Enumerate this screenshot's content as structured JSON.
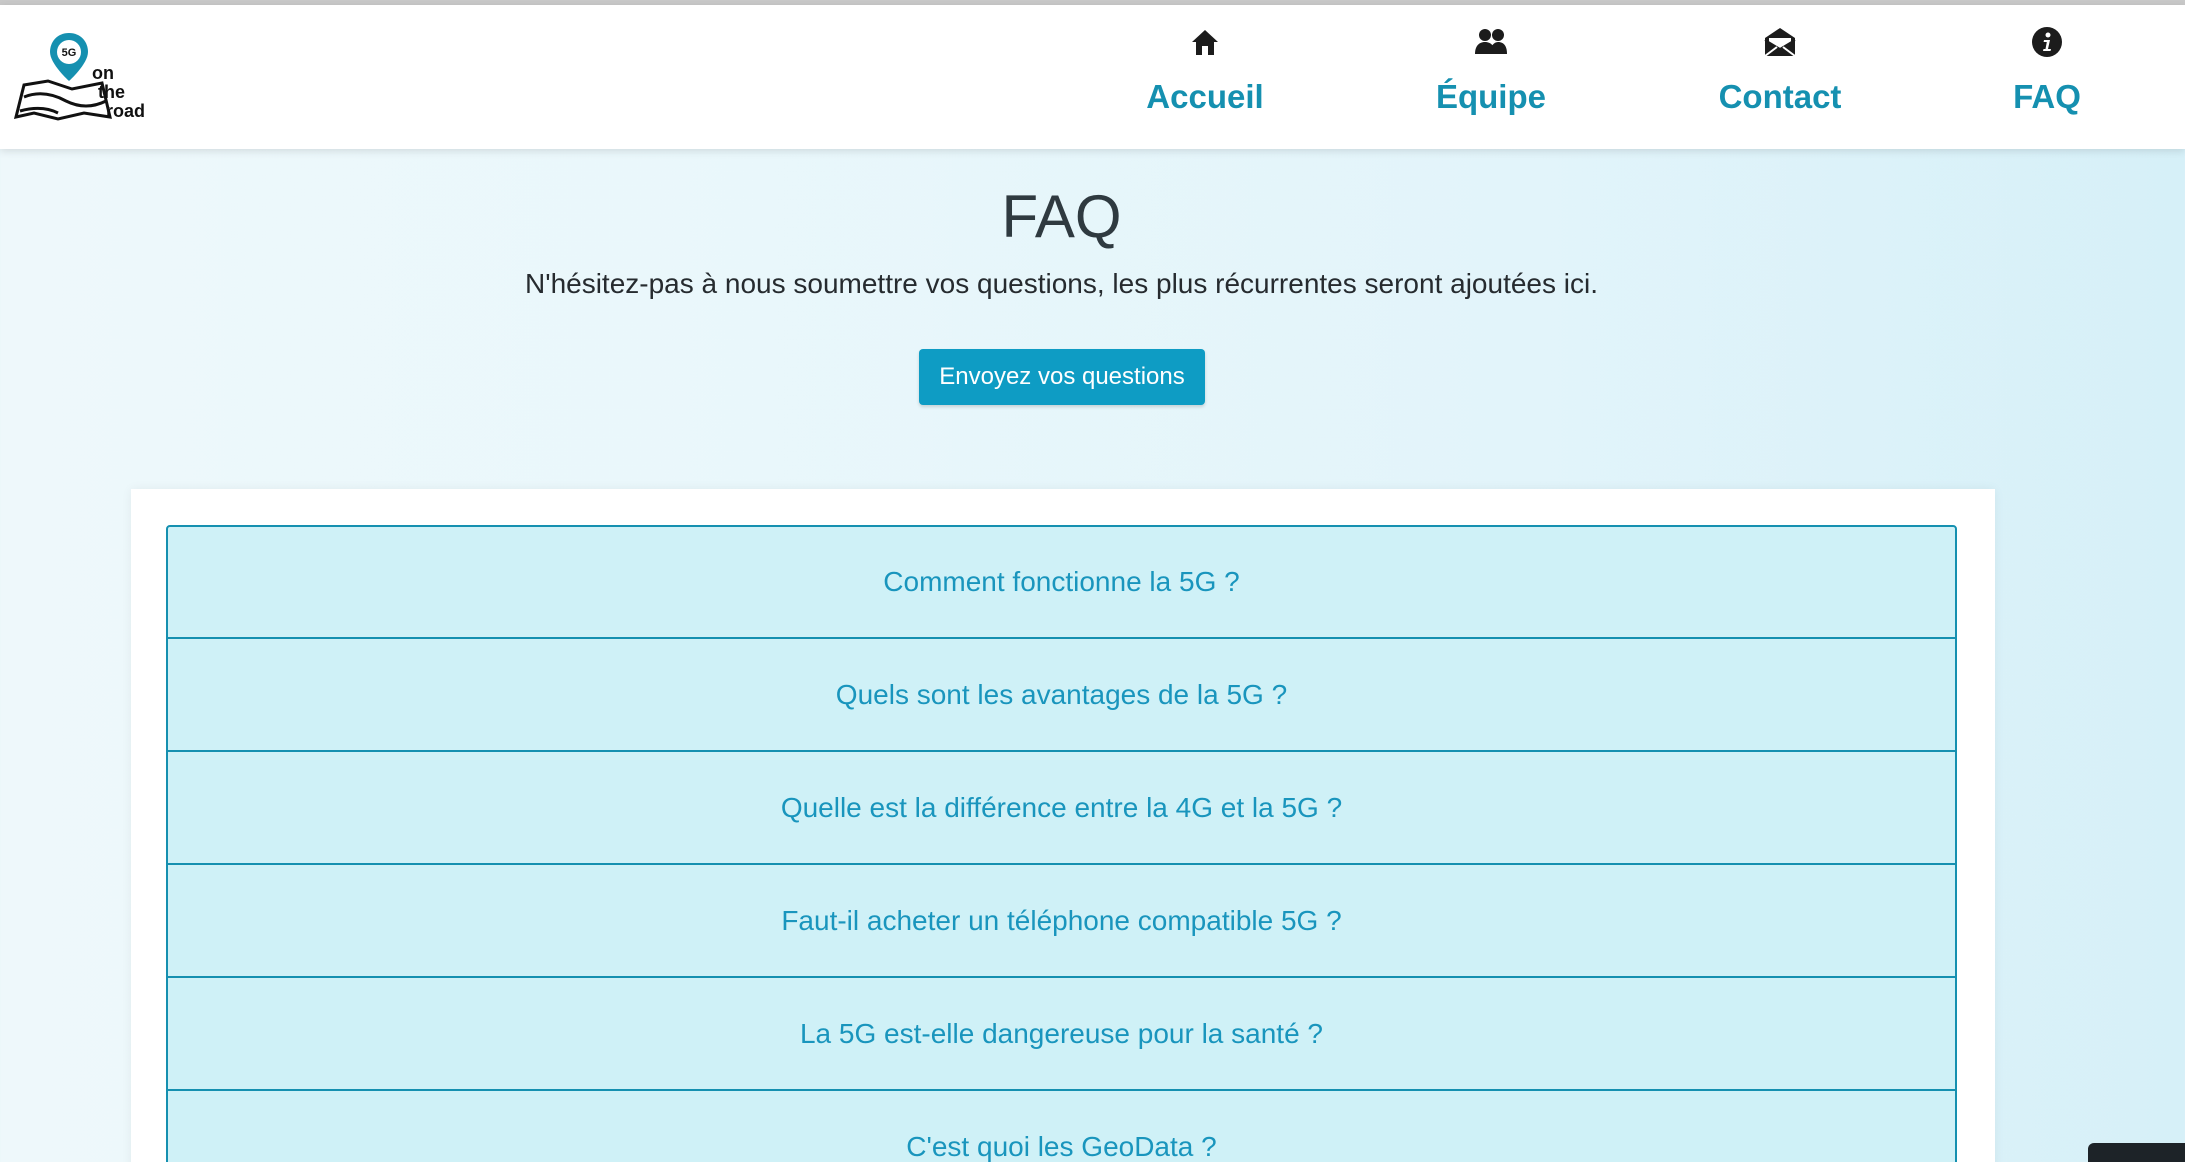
{
  "header": {
    "logo": {
      "badge_text": "5G",
      "line1": "on",
      "line2": "the",
      "line3": "road"
    },
    "nav": [
      {
        "label": "Accueil",
        "icon": "home-icon"
      },
      {
        "label": "Équipe",
        "icon": "users-icon"
      },
      {
        "label": "Contact",
        "icon": "envelope-open-icon"
      },
      {
        "label": "FAQ",
        "icon": "info-circle-icon"
      }
    ]
  },
  "main": {
    "title": "FAQ",
    "subtitle": "N'hésitez-pas à nous soumettre vos questions, les plus récurrentes seront ajoutées ici.",
    "cta_label": "Envoyez vos questions",
    "questions": [
      "Comment fonctionne la 5G ?",
      "Quels sont les avantages de la 5G ?",
      "Quelle est la différence entre la 4G et la 5G ?",
      "Faut-il acheter un téléphone compatible 5G ?",
      "La 5G est-elle dangereuse pour la santé ?",
      "C'est quoi les GeoData ?"
    ]
  },
  "colors": {
    "accent": "#1590b0",
    "button": "#0e9cc4",
    "faq_item_bg": "#cff1f7",
    "nav_icon": "#1c1c1c"
  }
}
